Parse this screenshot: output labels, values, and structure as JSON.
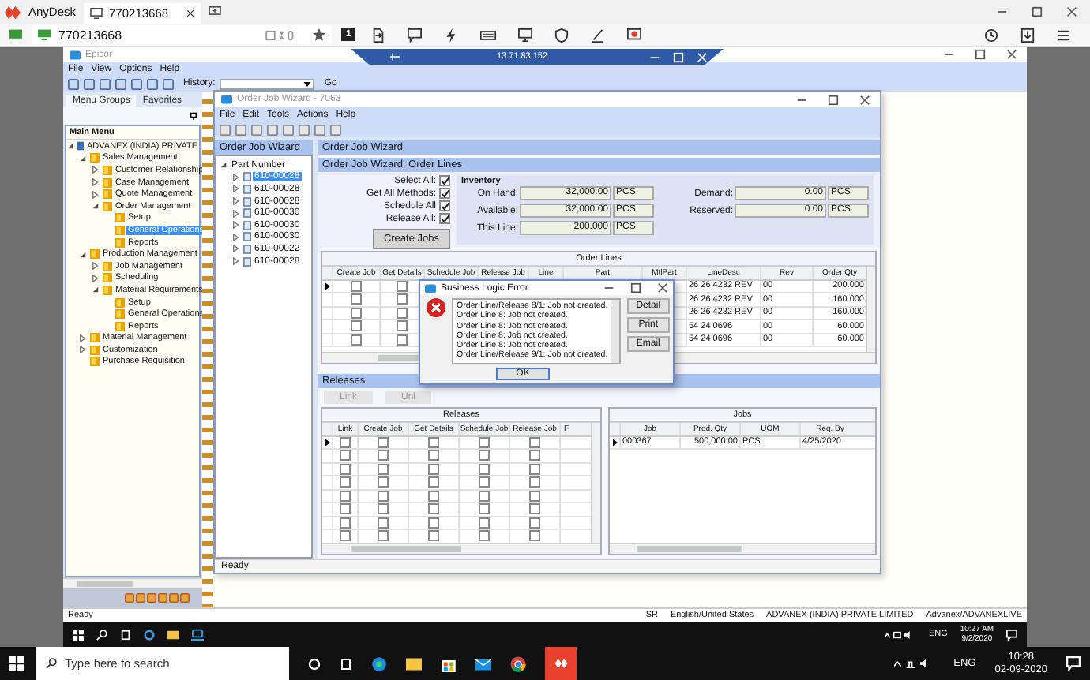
{
  "anydesk": {
    "app_name": "AnyDesk",
    "tab": "770213668",
    "address": "770213668",
    "session_number": "1"
  },
  "remote_bar": {
    "address": "13.71.83.152"
  },
  "epicor": {
    "title": "Epicor",
    "menu": [
      "File",
      "View",
      "Options",
      "Help"
    ],
    "history_label": "History:",
    "go": "Go",
    "side_tabs": [
      {
        "label": "Menu Groups",
        "selected": true
      },
      {
        "label": "Favorites",
        "selected": false
      }
    ],
    "main_menu_title": "Main Menu",
    "menu_tree": [
      {
        "label": "ADVANEX (INDIA) PRIVATE",
        "expanded": true,
        "selected": false,
        "children": [
          {
            "label": "Sales Management",
            "expanded": true,
            "selected": false,
            "children": [
              {
                "label": "Customer Relationship",
                "expanded": false,
                "selected": false
              },
              {
                "label": "Case Management",
                "expanded": false,
                "selected": false
              },
              {
                "label": "Quote Management",
                "expanded": false,
                "selected": false
              },
              {
                "label": "Order Management",
                "expanded": true,
                "selected": false,
                "children": [
                  {
                    "label": "Setup",
                    "selected": false
                  },
                  {
                    "label": "General Operations",
                    "selected": true
                  },
                  {
                    "label": "Reports",
                    "selected": false
                  }
                ]
              }
            ]
          },
          {
            "label": "Production Management",
            "expanded": true,
            "selected": false,
            "children": [
              {
                "label": "Job Management",
                "expanded": false,
                "selected": false
              },
              {
                "label": "Scheduling",
                "expanded": false,
                "selected": false
              },
              {
                "label": "Material Requirements",
                "expanded": true,
                "selected": false,
                "children": [
                  {
                    "label": "Setup",
                    "selected": false
                  },
                  {
                    "label": "General Operations",
                    "selected": false
                  },
                  {
                    "label": "Reports",
                    "selected": false
                  }
                ]
              }
            ]
          },
          {
            "label": "Material Management",
            "expanded": false,
            "selected": false
          },
          {
            "label": "Customization",
            "expanded": false,
            "selected": false
          },
          {
            "label": "Purchase Requisition",
            "selected": false
          }
        ]
      }
    ],
    "status_bar": {
      "left": "Ready",
      "items": [
        "SR",
        "English/United States",
        "ADVANEX (INDIA) PRIVATE LIMITED",
        "Advanex/ADVANEXLIVE"
      ]
    }
  },
  "wizard": {
    "title": "Order Job Wizard - 7063",
    "menu": [
      "File",
      "Edit",
      "Tools",
      "Actions",
      "Help"
    ],
    "tree_header": "Order Job Wizard",
    "tree": {
      "label": "Part Number",
      "expanded": true,
      "children": [
        {
          "label": "610-00028",
          "expanded": false,
          "selected": true
        },
        {
          "label": "610-00028",
          "expanded": false,
          "selected": false
        },
        {
          "label": "610-00028",
          "expanded": false,
          "selected": false
        },
        {
          "label": "610-00030",
          "expanded": false,
          "selected": false
        },
        {
          "label": "610-00030",
          "expanded": false,
          "selected": false
        },
        {
          "label": "610-00030",
          "expanded": false,
          "selected": false
        },
        {
          "label": "610-00022",
          "expanded": false,
          "selected": false
        },
        {
          "label": "610-00028",
          "expanded": false,
          "selected": false
        }
      ]
    },
    "header": "Order Job Wizard",
    "subheader": "Order Job Wizard, Order Lines",
    "options": [
      {
        "label": "Select All:",
        "checked": true
      },
      {
        "label": "Get All Methods:",
        "checked": true
      },
      {
        "label": "Schedule All",
        "checked": true
      },
      {
        "label": "Release All:",
        "checked": true
      }
    ],
    "create_jobs": "Create Jobs",
    "inventory": {
      "title": "Inventory",
      "fields": [
        {
          "label": "On Hand:",
          "value": "32,000.00",
          "uom": "PCS"
        },
        {
          "label": "Available:",
          "value": "32,000.00",
          "uom": "PCS"
        },
        {
          "label": "This Line:",
          "value": "200.000",
          "uom": "PCS"
        },
        {
          "label": "Demand:",
          "value": "0.00",
          "uom": "PCS"
        },
        {
          "label": "Reserved:",
          "value": "0.00",
          "uom": "PCS"
        }
      ]
    },
    "order_lines": {
      "title": "Order Lines",
      "columns": [
        "Create Job",
        "Get Details",
        "Schedule Job",
        "Release Job",
        "Line",
        "Part",
        "MtlPart",
        "LineDesc",
        "Rev",
        "Order Qty"
      ],
      "rows": [
        {
          "current": true,
          "create_job": false,
          "get_details": false,
          "line_desc": "26 26 4232  REV",
          "rev": "00",
          "order_qty": "200.000"
        },
        {
          "current": false,
          "create_job": false,
          "get_details": false,
          "line_desc": "26 26 4232  REV",
          "rev": "00",
          "order_qty": "160.000"
        },
        {
          "current": false,
          "create_job": false,
          "get_details": false,
          "line_desc": "26 26 4232  REV",
          "rev": "00",
          "order_qty": "160.000"
        },
        {
          "current": false,
          "create_job": false,
          "get_details": false,
          "line_desc": "54 24  0696",
          "rev": "00",
          "order_qty": "60.000"
        },
        {
          "current": false,
          "create_job": false,
          "get_details": false,
          "line_desc": "54 24  0696",
          "rev": "00",
          "order_qty": "60.000"
        }
      ]
    },
    "releases_header": "Releases",
    "link_button": "Link",
    "unlink_button": "Unl",
    "releases": {
      "title": "Releases",
      "columns": [
        "Link",
        "Create Job",
        "Get Details",
        "Schedule Job",
        "Release Job",
        "F"
      ],
      "rows": [
        {
          "current": true,
          "checks": [
            false,
            false,
            false,
            false,
            false
          ]
        },
        {
          "current": false,
          "checks": [
            false,
            false,
            false,
            false,
            false
          ]
        },
        {
          "current": false,
          "checks": [
            false,
            false,
            false,
            false,
            false
          ]
        },
        {
          "current": false,
          "checks": [
            false,
            false,
            false,
            false,
            false
          ]
        },
        {
          "current": false,
          "checks": [
            false,
            false,
            false,
            false,
            false
          ]
        },
        {
          "current": false,
          "checks": [
            false,
            false,
            false,
            false,
            false
          ]
        },
        {
          "current": false,
          "checks": [
            false,
            false,
            false,
            false,
            false
          ]
        },
        {
          "current": false,
          "checks": [
            false,
            false,
            false,
            false,
            false
          ]
        }
      ]
    },
    "jobs": {
      "title": "Jobs",
      "columns": [
        "Job",
        "Prod. Qty",
        "UOM",
        "Req. By"
      ],
      "rows": [
        {
          "current": true,
          "cells": [
            "000367",
            "500,000.00",
            "PCS",
            "4/25/2020"
          ]
        }
      ]
    },
    "status": "Ready"
  },
  "dialog": {
    "title": "Business Logic Error",
    "messages": [
      "Order Line/Release 8/1:  Job not created.",
      "Order Line 8:  Job not created.",
      "Order Line 8:  Job not created.",
      "Order Line 8:  Job not created.",
      "Order Line 8:  Job not created.",
      "Order Line/Release 9/1:  Job not created."
    ],
    "buttons": [
      "Detail",
      "Print",
      "Email"
    ],
    "ok": "OK"
  },
  "remote_taskbar": {
    "time": "10:27 AM",
    "date": "9/2/2020",
    "lang": "ENG"
  },
  "taskbar": {
    "search_placeholder": "Type here to search",
    "time": "10:28",
    "date": "02-09-2020",
    "lang": "ENG"
  }
}
